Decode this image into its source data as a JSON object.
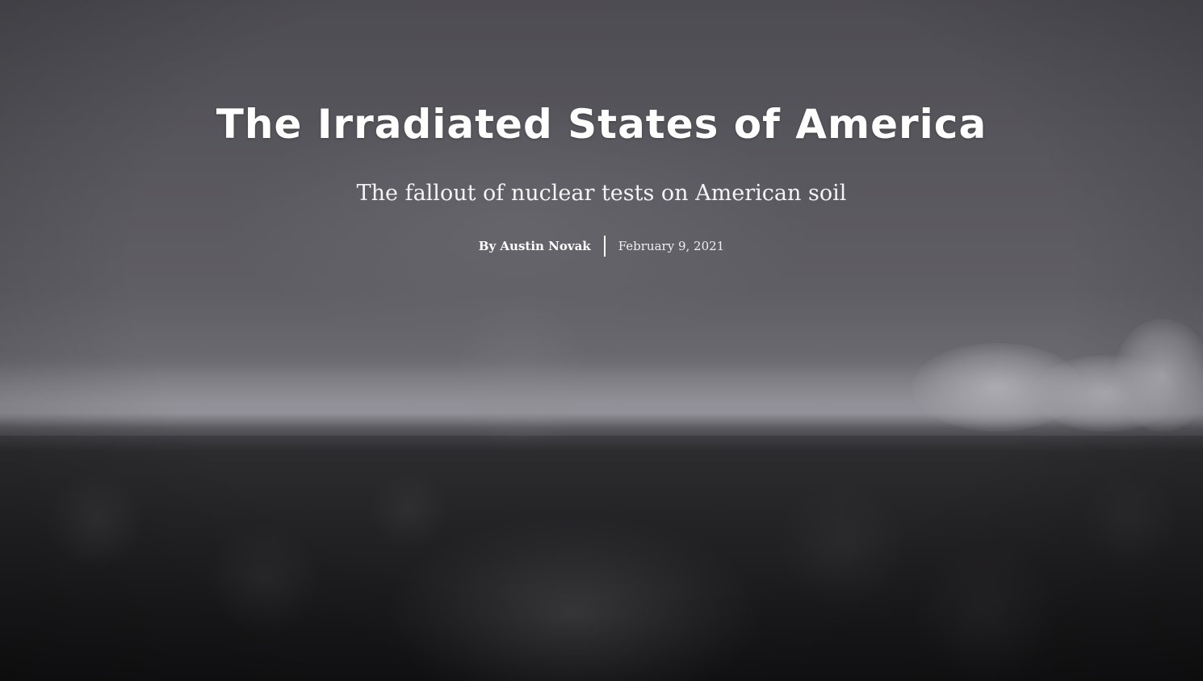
{
  "article": {
    "title": "The Irradiated States of America",
    "subtitle": "The fallout of nuclear tests on American soil",
    "byline": "By Austin Novak",
    "date": "February 9, 2021"
  },
  "colors": {
    "text": "#ffffff",
    "sky": "#4d4c52",
    "ground": "#1a1a1d"
  }
}
